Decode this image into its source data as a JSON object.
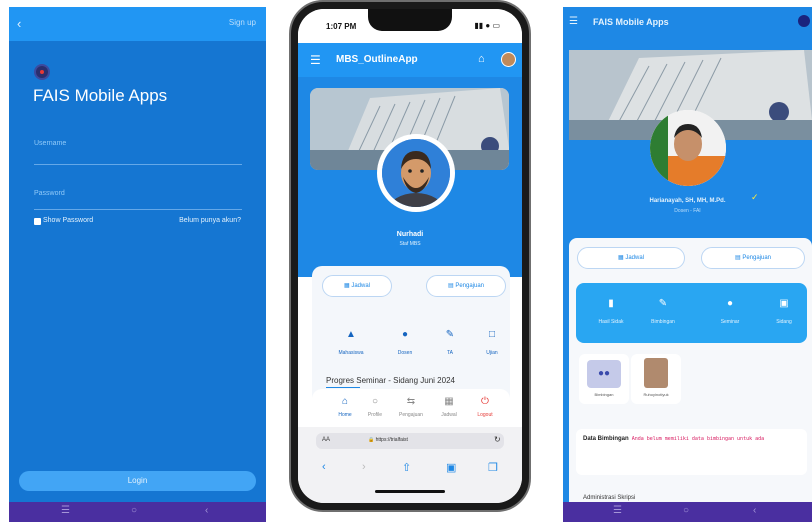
{
  "login": {
    "back_icon": "arrow-left-icon",
    "signup": "Sign up",
    "app_title": "FAIS Mobile Apps",
    "username_label": "Username",
    "password_label": "Password",
    "show_password": "Show Password",
    "no_account": "Belum punya akun?",
    "login_button": "Login"
  },
  "phone": {
    "time": "1:07 PM",
    "app_title": "MBS_OutlineApp",
    "user_name": "Nurhadi",
    "user_role": "Staf MBS",
    "btn_left": "Jadwal",
    "btn_right": "Pengajuan",
    "grid": [
      "Mahasiswa",
      "Dosen",
      "TA",
      "Ujian"
    ],
    "progress_title": "Progres Seminar - Sidang Juni 2024",
    "bottom_nav": [
      "Home",
      "Profile",
      "Pengajuan",
      "Jadwal",
      "Logout"
    ],
    "url_prefix": "AA",
    "url": "https://trialfaist"
  },
  "profile": {
    "app_title": "FAIS Mobile Apps",
    "name": "Harianayah, SH, MH, M.Pd.",
    "role": "Dosen - FAI",
    "btn_left": "Jadwal",
    "btn_right": "Pengajuan",
    "menu": [
      "Hasil Sidak",
      "Bimbingan",
      "Seminar",
      "Sidang"
    ],
    "tiles": [
      "Bimbingan",
      "Ruhoyinotiyuk"
    ],
    "data_title": "Data Bimbingan",
    "data_text": "Anda belum memiliki data bimbingan untuk ada",
    "admin": "Administrasi Skripsi"
  },
  "colors": {
    "primary": "#1e88e5",
    "login_bg": "#1576d2",
    "nav_purple": "#4a2fa0"
  }
}
